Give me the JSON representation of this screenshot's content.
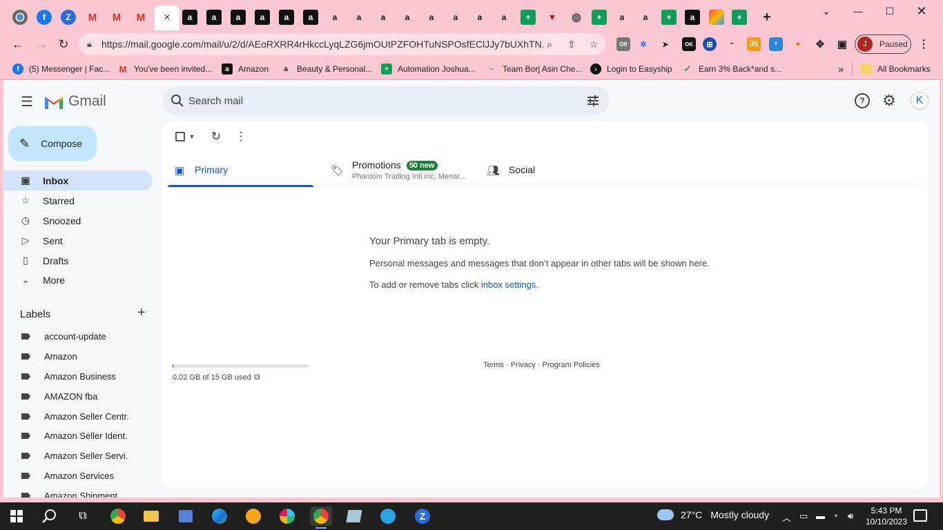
{
  "browser": {
    "active_tab_close": "×",
    "new_tab": "+",
    "url": "https://mail.google.com/mail/u/2/d/AEoRXRR4rHkccLyqLZG6jmOUtPZFOHTuNSPOsfEClJJy7bUXhTN...",
    "profile_initial": "J",
    "profile_status": "Paused",
    "ext_badge_off": "Off",
    "ext_badge_ok": "OK",
    "ext_js": "JS"
  },
  "bookmarks": {
    "items": [
      "(5) Messenger | Fac...",
      "You've been invited...",
      "Amazon",
      "Beauty & Personal...",
      "Automation Joshua...",
      "Team Borj Asin Che...",
      "Login to Easyship",
      "Earn 3% Back*and s..."
    ],
    "overflow": "»",
    "all_bookmarks": "All Bookmarks"
  },
  "gmail": {
    "logo_text": "Gmail",
    "search_placeholder": "Search mail",
    "account_initial": "K",
    "compose": "Compose",
    "nav": [
      {
        "label": "Inbox",
        "icon": "inbox-icon"
      },
      {
        "label": "Starred",
        "icon": "star-icon"
      },
      {
        "label": "Snoozed",
        "icon": "clock-icon"
      },
      {
        "label": "Sent",
        "icon": "send-icon"
      },
      {
        "label": "Drafts",
        "icon": "draft-icon"
      },
      {
        "label": "More",
        "icon": "chevron-down-icon"
      }
    ],
    "labels_title": "Labels",
    "labels": [
      "account-update",
      "Amazon",
      "Amazon Business",
      "AMAZON fba",
      "Amazon Seller Centr.",
      "Amazon Seller Ident.",
      "Amazon Seller Servi.",
      "Amazon Services",
      "Amazon Shipment"
    ],
    "tabs": {
      "primary": "Primary",
      "promotions": "Promotions",
      "promotions_badge": "50 new",
      "promotions_snippet": "Phantom Trading Intl inc, Menar...",
      "social": "Social"
    },
    "empty": {
      "title": "Your Primary tab is empty.",
      "description": "Personal messages and messages that don’t appear in other tabs will be shown here.",
      "settings_prefix": "To add or remove tabs click ",
      "settings_link": "inbox settings",
      "settings_suffix": "."
    },
    "storage": {
      "text": "0.02 GB of 15 GB used",
      "used_fraction": 0.0013
    },
    "footer": "Terms · Privacy · Program Policies"
  },
  "taskbar": {
    "temperature": "27°C",
    "weather": "Mostly cloudy",
    "time": "5:43 PM",
    "date": "10/10/2023"
  },
  "colors": {
    "browser_frame": "#f9c8d2",
    "gmail_bg": "#f6f8fc",
    "compose": "#c2e7ff",
    "active_nav": "#d3e3fd",
    "primary_blue": "#0b57d0",
    "badge_green": "#188038"
  }
}
